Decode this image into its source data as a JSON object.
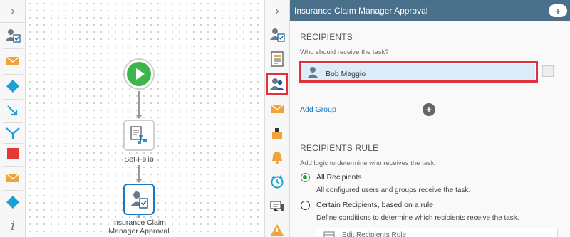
{
  "toolbox": {
    "collapse_icon": "chevron-right-icon",
    "tools": [
      "user-task-icon",
      "email-icon",
      "diamond-icon",
      "branch-icon",
      "merge-icon",
      "stop-icon",
      "email-icon",
      "diamond-icon",
      "info-icon"
    ],
    "info_label": "i"
  },
  "canvas": {
    "nodes": [
      {
        "type": "start",
        "label": ""
      },
      {
        "type": "set-folio",
        "label": "Set Folio"
      },
      {
        "type": "user-task",
        "label_line1": "Insurance Claim",
        "label_line2": "Manager Approval"
      }
    ]
  },
  "rail": {
    "collapse_icon": "chevron-right-icon",
    "items": [
      "task-properties-icon",
      "form-icon",
      "recipients-icon",
      "notification-icon",
      "actions-icon",
      "alerts-icon",
      "timer-icon",
      "reference-icon",
      "warning-icon"
    ],
    "active_item": "recipients-icon"
  },
  "panel": {
    "title": "Insurance Claim Manager Approval",
    "add_label": "+",
    "recipients_title": "RECIPIENTS",
    "recipients_hint": "Who should receive the task?",
    "recipient_name": "Bob Maggio",
    "add_group": "Add Group",
    "plus": "+",
    "rule_title": "RECIPIENTS RULE",
    "rule_hint": "Add logic to determine who receives the task.",
    "option1_label": "All Recipients",
    "option1_desc": "All configured users and groups receive the task.",
    "option2_label": "Certain Recipients, based on a rule",
    "option2_desc": "Define conditions to determine which recipients receive the task.",
    "edit_rule": "Edit Recipients Rule",
    "selected_option": "All Recipients"
  },
  "colors": {
    "header": "#4a6f8a",
    "highlight": "#e2313c",
    "link": "#1a78c2",
    "start_green": "#3db54a",
    "accent_blue": "#1aa0d8",
    "task_orange": "#f0a33a",
    "stop_red": "#e53935"
  }
}
